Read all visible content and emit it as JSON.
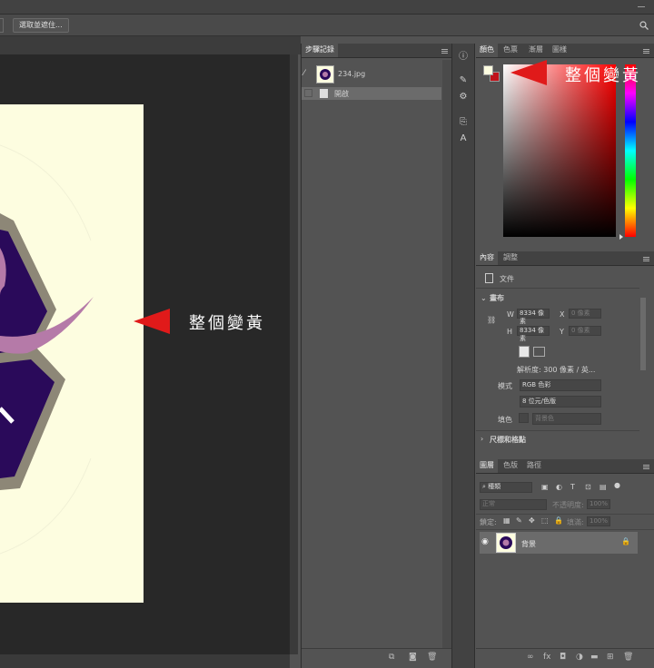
{
  "options_bar": {
    "select_mask_button": "選取並遮住..."
  },
  "canvas": {
    "annotation": "整個變黃"
  },
  "history_panel": {
    "tab": "步驟記錄",
    "snapshot_name": "234.jpg",
    "step_open": "開啟"
  },
  "color_panel": {
    "tabs": [
      "顏色",
      "色票",
      "漸層",
      "圖樣"
    ],
    "annotation": "整個變黃",
    "foreground_color": "#fdfde0",
    "background_color": "#c0131a"
  },
  "properties_panel": {
    "tabs": [
      "內容",
      "調整"
    ],
    "doc_label": "文件",
    "section_canvas": "畫布",
    "w_label": "W",
    "w_value": "8334 像素",
    "x_label": "X",
    "x_placeholder": "0 像素",
    "h_label": "H",
    "h_value": "8334 像素",
    "y_label": "Y",
    "y_placeholder": "0 像素",
    "resolution": "解析度: 300 像素 / 英...",
    "mode_label": "模式",
    "mode_value": "RGB 色彩",
    "bit_value": "8 位元/色版",
    "fill_label": "填色",
    "fill_value": "背景色",
    "section_rulers": "尺標和格點"
  },
  "layers_panel": {
    "tabs": [
      "圖層",
      "色版",
      "路徑"
    ],
    "filter_value": "種類",
    "blend_mode": "正常",
    "opacity_label": "不透明度:",
    "opacity_value": "100%",
    "lock_label": "鎖定:",
    "fill_label": "填滿:",
    "fill_value": "100%",
    "layer_name": "背景"
  }
}
